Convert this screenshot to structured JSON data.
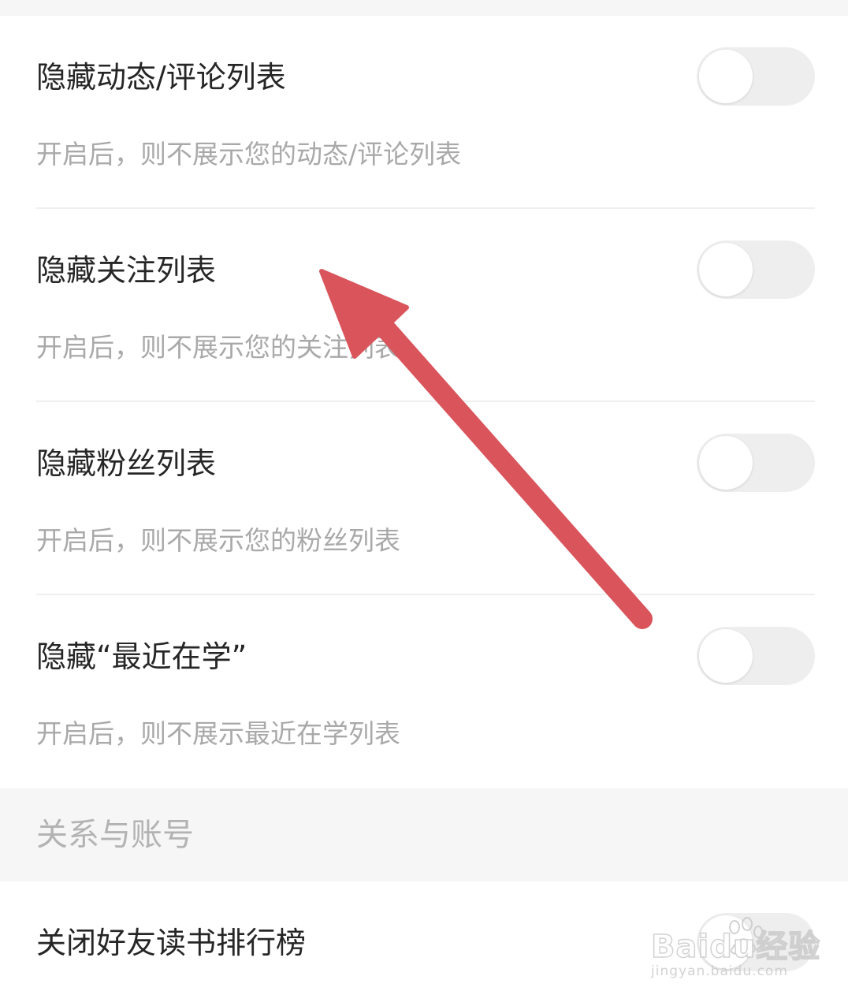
{
  "settings": [
    {
      "title": "隐藏动态/评论列表",
      "desc": "开启后，则不展示您的动态/评论列表",
      "enabled": false
    },
    {
      "title": "隐藏关注列表",
      "desc": "开启后，则不展示您的关注列表",
      "enabled": false
    },
    {
      "title": "隐藏粉丝列表",
      "desc": "开启后，则不展示您的粉丝列表",
      "enabled": false
    },
    {
      "title": "隐藏“最近在学”",
      "desc": "开启后，则不展示最近在学列表",
      "enabled": false
    }
  ],
  "section": {
    "title": "关系与账号",
    "items": [
      {
        "title": "关闭好友读书排行榜",
        "enabled": false
      }
    ]
  },
  "annotation": {
    "arrow_color": "#d9545b",
    "icon": "arrow-up-left-icon"
  },
  "watermark": {
    "brand": "Baidu经验",
    "url": "jingyan.baidu.com"
  },
  "colors": {
    "title": "#262626",
    "description": "#a9a9a9",
    "section_header_bg": "#f6f6f6",
    "toggle_off": "#eeeeee"
  }
}
